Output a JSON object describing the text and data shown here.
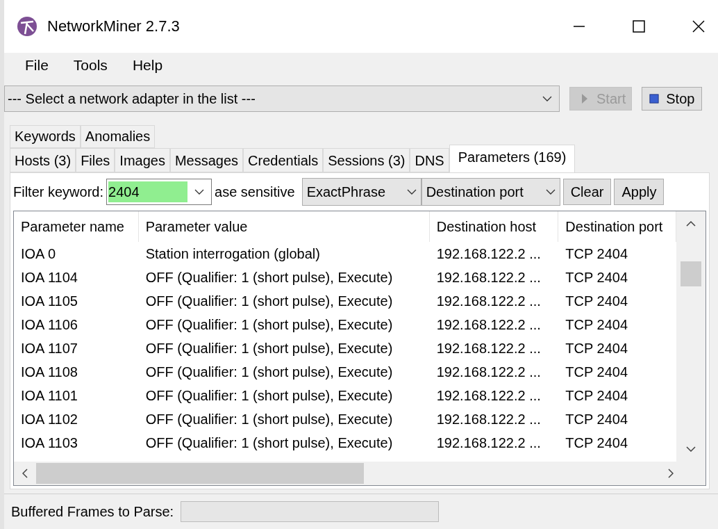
{
  "window": {
    "title": "NetworkMiner 2.7.3"
  },
  "menu": [
    "File",
    "Tools",
    "Help"
  ],
  "adapter": {
    "value": "--- Select a network adapter in the list ---"
  },
  "buttons": [
    {
      "kind": "start",
      "label": "Start",
      "disabled": true
    },
    {
      "kind": "stop",
      "label": "Stop",
      "disabled": false
    }
  ],
  "tab_rows": [
    [
      {
        "label": "Keywords",
        "selected": false
      },
      {
        "label": "Anomalies",
        "selected": false
      }
    ],
    [
      {
        "label": "Hosts (3)",
        "selected": false
      },
      {
        "label": "Files",
        "selected": false
      },
      {
        "label": "Images",
        "selected": false
      },
      {
        "label": "Messages",
        "selected": false
      },
      {
        "label": "Credentials",
        "selected": false
      },
      {
        "label": "Sessions (3)",
        "selected": false
      },
      {
        "label": "DNS",
        "selected": false
      },
      {
        "label": "Parameters (169)",
        "selected": true
      }
    ]
  ],
  "filter": {
    "label": "Filter keyword:",
    "value": "2404",
    "case_label": "ase sensitive",
    "match_mode": "ExactPhrase",
    "field": "Destination port",
    "clear": "Clear",
    "apply": "Apply"
  },
  "table": {
    "columns": [
      "Parameter name",
      "Parameter value",
      "Destination host",
      "Destination port"
    ],
    "rows": [
      [
        "IOA 0",
        "Station interrogation (global)",
        "192.168.122.2 ...",
        "TCP 2404"
      ],
      [
        "IOA 1104",
        "OFF (Qualifier: 1 (short pulse),  Execute)",
        "192.168.122.2 ...",
        "TCP 2404"
      ],
      [
        "IOA 1105",
        "OFF (Qualifier: 1 (short pulse),  Execute)",
        "192.168.122.2 ...",
        "TCP 2404"
      ],
      [
        "IOA 1106",
        "OFF (Qualifier: 1 (short pulse),  Execute)",
        "192.168.122.2 ...",
        "TCP 2404"
      ],
      [
        "IOA 1107",
        "OFF (Qualifier: 1 (short pulse),  Execute)",
        "192.168.122.2 ...",
        "TCP 2404"
      ],
      [
        "IOA 1108",
        "OFF (Qualifier: 1 (short pulse),  Execute)",
        "192.168.122.2 ...",
        "TCP 2404"
      ],
      [
        "IOA 1101",
        "OFF (Qualifier: 1 (short pulse),  Execute)",
        "192.168.122.2 ...",
        "TCP 2404"
      ],
      [
        "IOA 1102",
        "OFF (Qualifier: 1 (short pulse),  Execute)",
        "192.168.122.2 ...",
        "TCP 2404"
      ],
      [
        "IOA 1103",
        "OFF (Qualifier: 1 (short pulse),  Execute)",
        "192.168.122.2 ...",
        "TCP 2404"
      ]
    ]
  },
  "status_bar": {
    "label": "Buffered Frames to Parse:"
  }
}
